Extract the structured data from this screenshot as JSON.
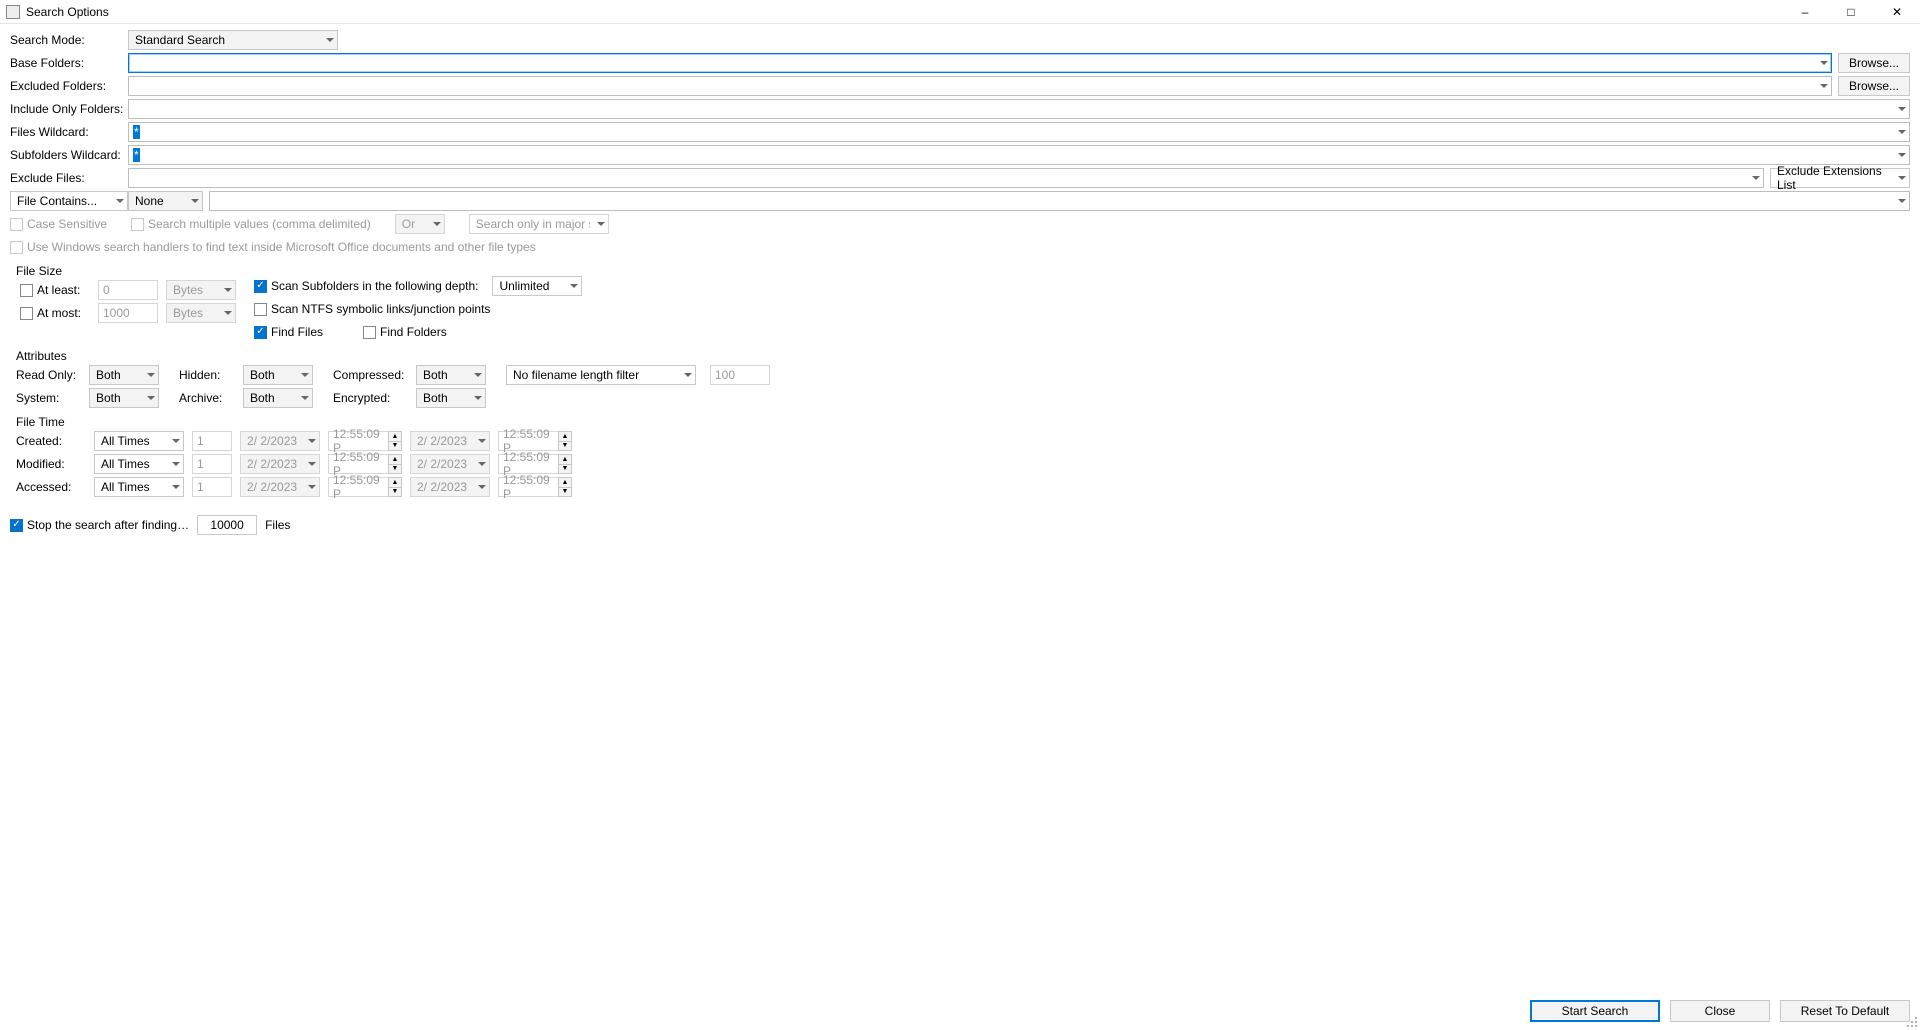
{
  "window": {
    "title": "Search Options"
  },
  "form": {
    "labels": {
      "search_mode": "Search Mode:",
      "base_folders": "Base Folders:",
      "excluded_folders": "Excluded Folders:",
      "include_only_folders": "Include Only Folders:",
      "files_wildcard": "Files Wildcard:",
      "subfolders_wildcard": "Subfolders Wildcard:",
      "exclude_files": "Exclude Files:"
    },
    "search_mode": "Standard Search",
    "base_folders": "",
    "excluded_folders": "",
    "include_only_folders": "",
    "files_wildcard": "*",
    "subfolders_wildcard": "*",
    "exclude_files": "",
    "exclude_extensions_label": "Exclude Extensions List",
    "browse": "Browse...",
    "file_contains_label": "File Contains...",
    "file_contains_mode": "None",
    "case_sensitive": "Case Sensitive",
    "multi_values": "Search multiple values (comma delimited)",
    "logic": "Or",
    "major_strings": "Search only in major strings",
    "use_handlers": "Use Windows search handlers to find text inside Microsoft Office documents and other file types"
  },
  "file_size": {
    "legend": "File Size",
    "at_least": "At least:",
    "at_least_val": "0",
    "at_least_unit": "Bytes",
    "at_most": "At most:",
    "at_most_val": "1000",
    "at_most_unit": "Bytes"
  },
  "scan": {
    "scan_subfolders": "Scan Subfolders in the following depth:",
    "depth": "Unlimited",
    "scan_ntfs": "Scan NTFS symbolic links/junction points",
    "find_files": "Find Files",
    "find_folders": "Find Folders"
  },
  "attributes": {
    "legend": "Attributes",
    "read_only": "Read Only:",
    "hidden": "Hidden:",
    "compressed": "Compressed:",
    "system": "System:",
    "archive": "Archive:",
    "encrypted": "Encrypted:",
    "both": "Both",
    "filename_filter": "No filename length filter",
    "filename_len": "100"
  },
  "file_time": {
    "legend": "File Time",
    "created": "Created:",
    "modified": "Modified:",
    "accessed": "Accessed:",
    "all_times": "All Times",
    "last_n": "1",
    "date": "2/  2/2023",
    "time": "12:55:09 P"
  },
  "stop": {
    "label": "Stop the search after finding…",
    "count": "10000",
    "files": "Files"
  },
  "footer": {
    "start": "Start Search",
    "close": "Close",
    "reset": "Reset To Default"
  }
}
